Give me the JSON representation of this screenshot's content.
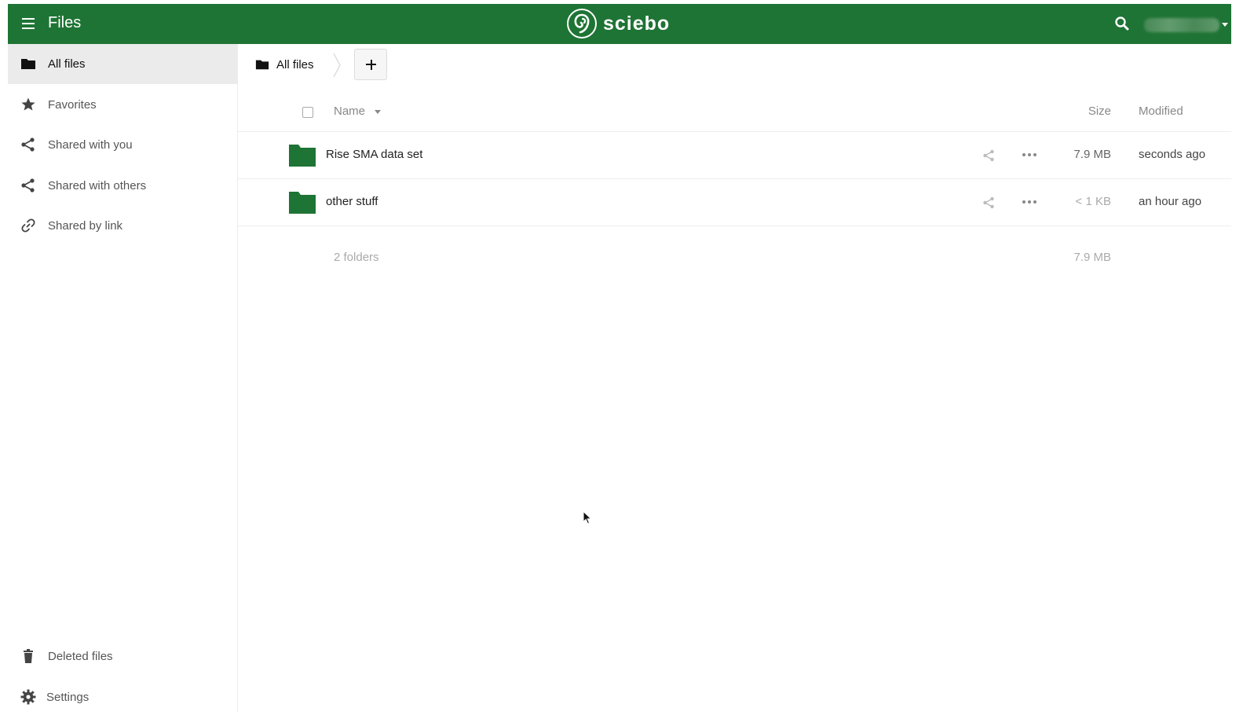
{
  "header": {
    "app_title": "Files",
    "brand": "sciebo",
    "colors": {
      "header_bg": "#1e7434",
      "folder": "#1e7434"
    }
  },
  "sidebar": {
    "items": [
      {
        "label": "All files",
        "icon": "folder-icon",
        "active": true
      },
      {
        "label": "Favorites",
        "icon": "star-icon"
      },
      {
        "label": "Shared with you",
        "icon": "share-icon"
      },
      {
        "label": "Shared with others",
        "icon": "share-icon"
      },
      {
        "label": "Shared by link",
        "icon": "link-icon"
      }
    ],
    "bottom": [
      {
        "label": "Deleted files",
        "icon": "trash-icon"
      },
      {
        "label": "Settings",
        "icon": "gear-icon"
      }
    ]
  },
  "breadcrumb": {
    "label": "All files"
  },
  "table": {
    "columns": {
      "name": "Name",
      "size": "Size",
      "modified": "Modified"
    },
    "rows": [
      {
        "name": "Rise SMA data set",
        "size": "7.9 MB",
        "modified": "seconds ago"
      },
      {
        "name": "other stuff",
        "size": "< 1 KB",
        "modified": "an hour ago"
      }
    ],
    "summary": {
      "count": "2 folders",
      "size": "7.9 MB"
    }
  }
}
